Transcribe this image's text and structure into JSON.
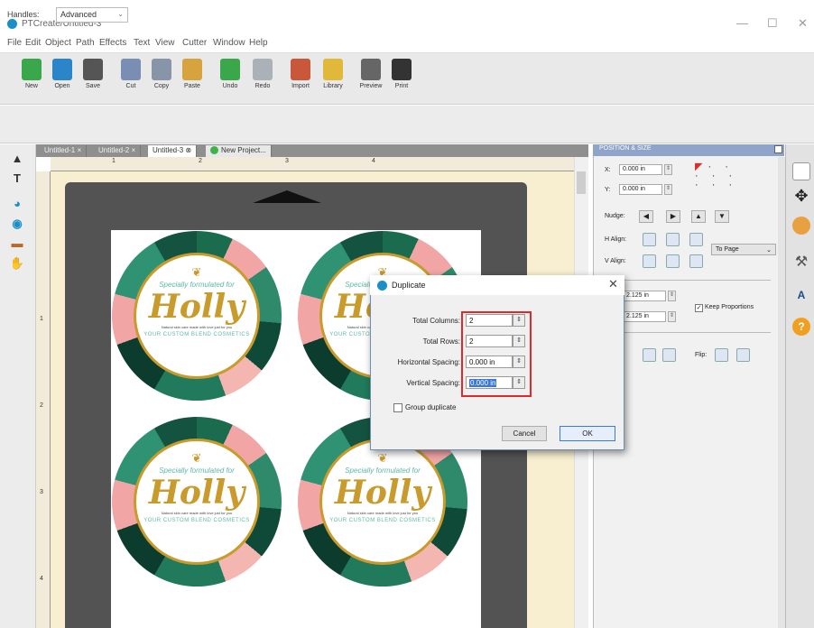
{
  "window": {
    "title": "PTCreate/Untitled-3",
    "minimize": "—",
    "maximize": "☐",
    "close": "✕"
  },
  "menu": [
    "File",
    "Edit",
    "Object",
    "Path",
    "Effects",
    "Text",
    "View",
    "Cutter",
    "Window",
    "Help"
  ],
  "toolbar": [
    {
      "label": "New",
      "color": "#3aa84a"
    },
    {
      "label": "Open",
      "color": "#2a86c9"
    },
    {
      "label": "Save",
      "color": "#555555"
    },
    {
      "label": "Cut",
      "color": "#7a8db3"
    },
    {
      "label": "Copy",
      "color": "#8894a8"
    },
    {
      "label": "Paste",
      "color": "#d7a33e"
    },
    {
      "label": "Undo",
      "color": "#3aa84a"
    },
    {
      "label": "Redo",
      "color": "#aab1b8"
    },
    {
      "label": "Import",
      "color": "#c9583a"
    },
    {
      "label": "Library",
      "color": "#e1b93a"
    },
    {
      "label": "Preview",
      "color": "#666666"
    },
    {
      "label": "Print",
      "color": "#333333"
    }
  ],
  "options": {
    "handles_label": "Handles:",
    "handles_value": "Advanced"
  },
  "left_tools": [
    "▲",
    "T",
    "◕",
    "◉",
    "▬",
    "✋"
  ],
  "tabs": [
    {
      "label": "Untitled-1 ×"
    },
    {
      "label": "Untitled-2 ×"
    },
    {
      "label": "Untitled-3 ⊗"
    },
    {
      "label": "New Project..."
    }
  ],
  "ruler_top": [
    "1",
    "2",
    "3",
    "4"
  ],
  "ruler_left": [
    "1",
    "2",
    "3",
    "4"
  ],
  "labels": [
    {
      "top_text": "Specially formulated for",
      "name": "Holly",
      "small_text": "Natural skin care made with love just for you",
      "bottom_text": "YOUR CUSTOM BLEND COSMETICS"
    },
    {
      "top_text": "Specially formulated for",
      "name": "Holly",
      "small_text": "Natural skin care made with love just for you",
      "bottom_text": "YOUR CUSTOM BLEND COSMETICS"
    },
    {
      "top_text": "Specially formulated for",
      "name": "Holly",
      "small_text": "Natural skin care made with love just for you",
      "bottom_text": "YOUR CUSTOM BLEND COSMETICS"
    },
    {
      "top_text": "Specially formulated for",
      "name": "Holly",
      "small_text": "Natural skin care made with love just for you",
      "bottom_text": "YOUR CUSTOM BLEND COSMETICS"
    }
  ],
  "panel": {
    "title": "POSITION & SIZE",
    "x_label": "X:",
    "x_value": "0.000 in",
    "y_label": "Y:",
    "y_value": "0.000 in",
    "nudge_label": "Nudge:",
    "halign_label": "H Align:",
    "valign_label": "V Align:",
    "to_page": "To Page",
    "w_value": "2.125 in",
    "h_value": "2.125 in",
    "keep_proportions": "Keep Proportions",
    "flip_label": "Flip:"
  },
  "dialog": {
    "title": "Duplicate",
    "total_columns_label": "Total Columns:",
    "total_columns_value": "2",
    "total_rows_label": "Total Rows:",
    "total_rows_value": "2",
    "h_spacing_label": "Horizontal Spacing:",
    "h_spacing_value": "0.000 in",
    "v_spacing_label": "Vertical Spacing:",
    "v_spacing_value": "0.000 in",
    "group_duplicate": "Group duplicate",
    "cancel": "Cancel",
    "ok": "OK"
  },
  "colors": {
    "accent": "#1a8fc7",
    "highlight": "#e02a2a",
    "label_gold": "#c99a2c",
    "label_teal": "#5fb8a8"
  }
}
